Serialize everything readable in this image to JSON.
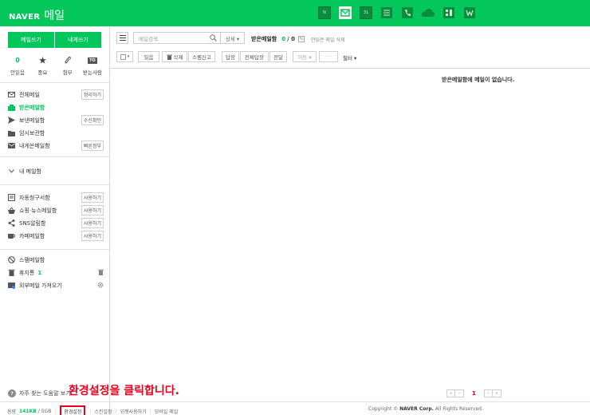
{
  "header": {
    "logo_naver": "NAVER",
    "logo_mail": "메일",
    "apps": [
      {
        "icon": "naver-app-icon",
        "label": "N"
      },
      {
        "icon": "mail-app-icon",
        "label": ""
      },
      {
        "icon": "calendar-app-icon",
        "label": "31"
      },
      {
        "icon": "contacts-app-icon",
        "label": ""
      },
      {
        "icon": "phone-app-icon",
        "label": ""
      },
      {
        "icon": "cloud-app-icon",
        "label": ""
      },
      {
        "icon": "office-app-icon",
        "label": ""
      },
      {
        "icon": "memo-app-icon",
        "label": ""
      }
    ],
    "accent": "#03c75a"
  },
  "sidebar": {
    "write_mail": "메일쓰기",
    "write_to_me": "내게쓰기",
    "quick": {
      "unread_count": "0",
      "unread_label": "안읽음",
      "important_label": "중요",
      "attach_label": "첨부",
      "to_badge": "TO",
      "to_label": "받는사람"
    },
    "folders": [
      {
        "label": "전체메일",
        "button": "정리하기"
      },
      {
        "label": "받은메일함",
        "button": ""
      },
      {
        "label": "보낸메일함",
        "button": "수신확인"
      },
      {
        "label": "임시보관함",
        "button": ""
      },
      {
        "label": "내게쓴메일함",
        "button": "빠른정부"
      }
    ],
    "my_mailbox": "내 메일함",
    "smart_folders": [
      {
        "label": "자동청구서함",
        "button": "사용하기"
      },
      {
        "label": "쇼핑·뉴스메일함",
        "button": "사용하기"
      },
      {
        "label": "SNS알림함",
        "button": "사용하기"
      },
      {
        "label": "카페메일함",
        "button": "사용하기"
      }
    ],
    "spam": "스팸메일함",
    "trash": "휴지통",
    "trash_count": "1",
    "external": "외부메일 가져오기"
  },
  "toolbar": {
    "search_placeholder": "메일검색",
    "detail": "상세 ▾",
    "inbox_title": "받은메일함",
    "unread": "0",
    "total": "/ 0",
    "delete_all": "안읽은 메일 삭제",
    "read": "읽음",
    "delete": "삭제",
    "spam": "스팸신고",
    "reply": "답장",
    "reply_all": "전체답장",
    "forward": "전달",
    "move": "이동 ▾",
    "more": "···",
    "filter": "필터 ▾"
  },
  "main": {
    "empty_message": "받은메일함에 메일이 없습니다."
  },
  "footer": {
    "faq": "자주 찾는 도움말 보기",
    "callout": "환경설정을 클릭합니다.",
    "capacity_label": "용량",
    "capacity_used": "141KB",
    "capacity_total": "/ 5GB",
    "settings": "환경설정",
    "spin_settings": "스킨설정",
    "widget": "위젯사용하기",
    "mobile": "모바일 메일",
    "page": "1",
    "copyright_prefix": "Copyright ©",
    "copyright_corp": "NAVER Corp.",
    "copyright_suffix": "All Rights Reserved."
  }
}
